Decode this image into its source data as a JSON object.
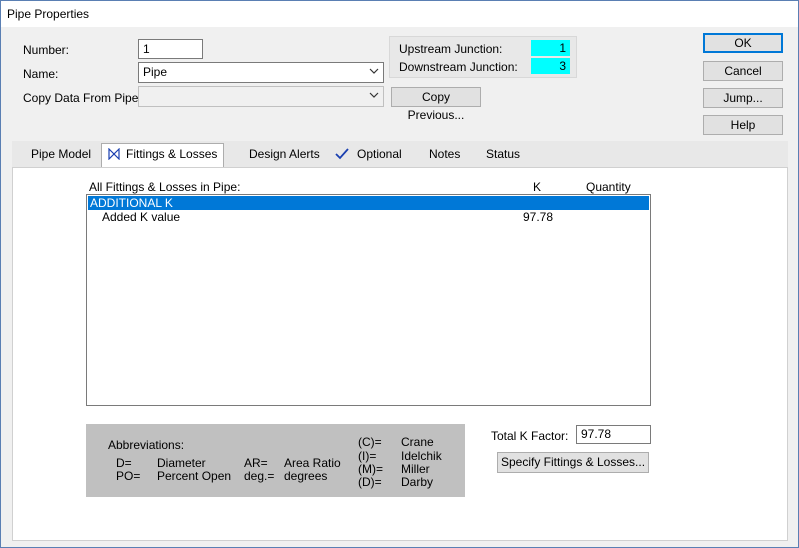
{
  "window": {
    "title": "Pipe Properties"
  },
  "form": {
    "number_label": "Number:",
    "number_value": "1",
    "name_label": "Name:",
    "name_value": "Pipe",
    "copy_label": "Copy Data From Pipe...",
    "copy_value": "",
    "copy_previous_label": "Copy Previous..."
  },
  "junctions": {
    "upstream_label": "Upstream Junction:",
    "upstream_value": "1",
    "downstream_label": "Downstream Junction:",
    "downstream_value": "3",
    "highlight_color": "#00ffff"
  },
  "buttons": {
    "ok": "OK",
    "cancel": "Cancel",
    "jump": "Jump...",
    "help": "Help"
  },
  "tabs": [
    {
      "label": "Pipe Model",
      "active": false
    },
    {
      "label": "Fittings & Losses",
      "active": true,
      "icon": "bowtie-valve-icon"
    },
    {
      "label": "Design Alerts",
      "active": false
    },
    {
      "label": "Optional",
      "active": false,
      "icon": "checkmark-icon"
    },
    {
      "label": "Notes",
      "active": false
    },
    {
      "label": "Status",
      "active": false
    }
  ],
  "fittings": {
    "list_header": "All Fittings & Losses in Pipe:",
    "k_header": "K",
    "quantity_header": "Quantity",
    "rows": [
      {
        "name": "ADDITIONAL K",
        "k": "",
        "quantity": "",
        "selected": true
      },
      {
        "name": "Added K value",
        "k": "97.78",
        "quantity": "",
        "selected": false
      }
    ],
    "selection_color": "#0078d7"
  },
  "abbreviations": {
    "title": "Abbreviations:",
    "d_key": "D=",
    "d_val": "Diameter",
    "po_key": "PO=",
    "po_val": "Percent Open",
    "ar_key": "AR=",
    "ar_val": "Area Ratio",
    "deg_key": "deg.=",
    "deg_val": "degrees",
    "c_key": "(C)=",
    "c_val": "Crane",
    "i_key": "(I)=",
    "i_val": "Idelchik",
    "m_key": "(M)=",
    "m_val": "Miller",
    "dd_key": "(D)=",
    "dd_val": "Darby"
  },
  "total_k": {
    "label": "Total K Factor:",
    "value": "97.78",
    "specify_label": "Specify Fittings & Losses..."
  }
}
